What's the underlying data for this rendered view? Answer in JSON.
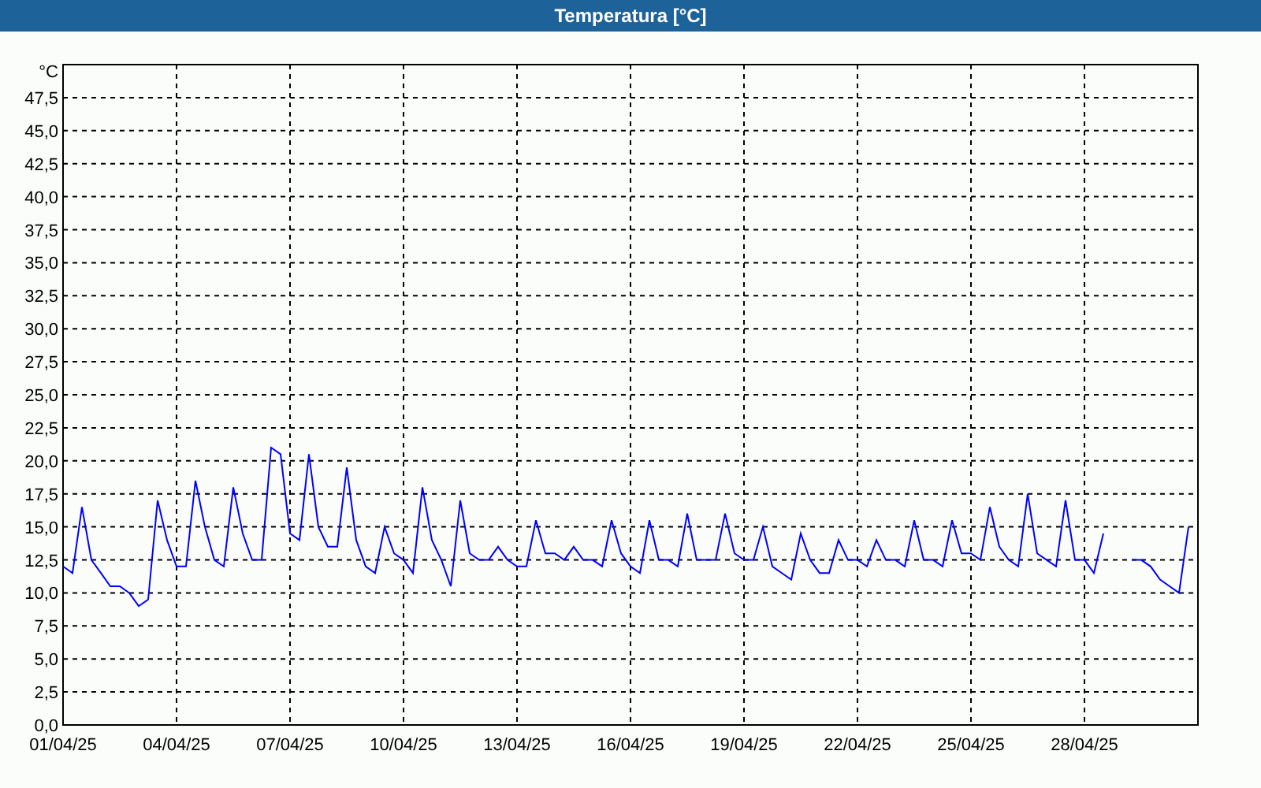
{
  "window": {
    "title": "Temperatura [°C]"
  },
  "chart": {
    "chart_data": {
      "type": "line",
      "grid": true,
      "ylabel": "°C",
      "ylim": [
        0,
        50
      ],
      "yticks": [
        {
          "value": 0,
          "label": "0,0"
        },
        {
          "value": 2.5,
          "label": "2,5"
        },
        {
          "value": 5,
          "label": "5,0"
        },
        {
          "value": 7.5,
          "label": "7,5"
        },
        {
          "value": 10,
          "label": "10,0"
        },
        {
          "value": 12.5,
          "label": "12,5"
        },
        {
          "value": 15,
          "label": "15,0"
        },
        {
          "value": 17.5,
          "label": "17,5"
        },
        {
          "value": 20,
          "label": "20,0"
        },
        {
          "value": 22.5,
          "label": "22,5"
        },
        {
          "value": 25,
          "label": "25,0"
        },
        {
          "value": 27.5,
          "label": "27,5"
        },
        {
          "value": 30,
          "label": "30,0"
        },
        {
          "value": 32.5,
          "label": "32,5"
        },
        {
          "value": 35,
          "label": "35,0"
        },
        {
          "value": 37.5,
          "label": "37,5"
        },
        {
          "value": 40,
          "label": "40,0"
        },
        {
          "value": 42.5,
          "label": "42,5"
        },
        {
          "value": 45,
          "label": "45,0"
        },
        {
          "value": 47.5,
          "label": "47,5"
        }
      ],
      "categories": [
        "01/04/25",
        null,
        null,
        null,
        null,
        null,
        null,
        null,
        null,
        null,
        null,
        null,
        "04/04/25",
        null,
        null,
        null,
        null,
        null,
        null,
        null,
        null,
        null,
        null,
        null,
        "07/04/25",
        null,
        null,
        null,
        null,
        null,
        null,
        null,
        null,
        null,
        null,
        null,
        "10/04/25",
        null,
        null,
        null,
        null,
        null,
        null,
        null,
        null,
        null,
        null,
        null,
        "13/04/25",
        null,
        null,
        null,
        null,
        null,
        null,
        null,
        null,
        null,
        null,
        null,
        "16/04/25",
        null,
        null,
        null,
        null,
        null,
        null,
        null,
        null,
        null,
        null,
        null,
        "19/04/25",
        null,
        null,
        null,
        null,
        null,
        null,
        null,
        null,
        null,
        null,
        null,
        "22/04/25",
        null,
        null,
        null,
        null,
        null,
        null,
        null,
        null,
        null,
        null,
        null,
        "25/04/25",
        null,
        null,
        null,
        null,
        null,
        null,
        null,
        null,
        null,
        null,
        null,
        "28/04/25",
        null,
        null,
        null,
        null,
        null,
        null,
        null,
        null,
        null,
        null,
        null
      ],
      "series": [
        {
          "color": "#0000ff",
          "values": [
            12,
            11.5,
            16.5,
            12.5,
            11.5,
            10.5,
            10.5,
            10,
            9,
            9.5,
            17,
            14,
            12,
            12,
            18.5,
            15,
            12.5,
            12,
            18,
            14.5,
            12.5,
            12.5,
            21,
            20.5,
            14.5,
            14,
            20.5,
            15,
            13.5,
            13.5,
            19.5,
            14,
            12,
            11.5,
            15,
            13,
            12.5,
            11.5,
            18,
            14,
            12.5,
            10.5,
            17,
            13,
            12.5,
            12.5,
            13.5,
            12.5,
            12,
            12,
            15.5,
            13,
            13,
            12.5,
            13.5,
            12.5,
            12.5,
            12,
            15.5,
            13,
            12,
            11.5,
            15.5,
            12.5,
            12.5,
            12,
            16,
            12.5,
            12.5,
            12.5,
            16,
            13,
            12.5,
            12.5,
            15,
            12,
            11.5,
            11,
            14.5,
            12.5,
            11.5,
            11.5,
            14,
            12.5,
            12.5,
            12,
            14,
            12.5,
            12.5,
            12,
            15.5,
            12.5,
            12.5,
            12,
            15.5,
            13,
            13,
            12.5,
            16.5,
            13.5,
            12.5,
            12,
            17.5,
            13,
            12.5,
            12,
            17,
            12.5,
            12.5,
            11.5,
            14.5,
            null,
            null,
            12.5,
            12.5,
            12,
            11,
            10.5,
            10,
            15
          ]
        }
      ]
    }
  }
}
